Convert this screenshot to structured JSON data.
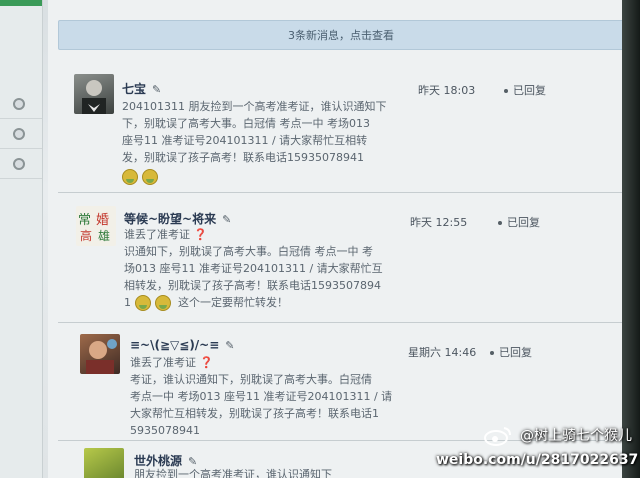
{
  "notice": {
    "text": "3条新消息，点击查看"
  },
  "posts": [
    {
      "author": "七宝",
      "lines": [
        "204101311 朋友捡到一个高考准考证，谁认识通知下",
        "下，别耽误了高考大事。白冠倩 考点一中 考场013",
        "座号11 准考证号204101311 / 请大家帮忙互相转",
        "发，别耽误了孩子高考！联系电话15935078941"
      ],
      "time": "昨天 18:03",
      "status": "已回复"
    },
    {
      "author": "等候~盼望~将来",
      "lines": [
        "谁丢了准考证",
        "识通知下，别耽误了高考大事。白冠倩 考点一中 考",
        "场013 座号11 准考证号204101311 / 请大家帮忙互",
        "相转发，别耽误了孩子高考！联系电话1593507894",
        "1",
        "这个一定要帮忙转发！"
      ],
      "time": "昨天 12:55",
      "status": "已回复"
    },
    {
      "author": "≡~\\(≧▽≦)/~≡",
      "lines": [
        "谁丢了准考证",
        "考证，谁认识通知下，别耽误了高考大事。白冠倩",
        "考点一中 考场013 座号11 准考证号204101311 / 请",
        "大家帮忙互相转发，别耽误了孩子高考！联系电话1",
        "5935078941"
      ],
      "time": "星期六 14:46",
      "status": "已回复"
    },
    {
      "author": "世外桃源",
      "lines": [
        "朋友捡到一个高考准考证，谁认识通知下"
      ]
    }
  ],
  "watermark": {
    "user": "@树上骑七个猴儿",
    "url": "weibo.com/u/2817022637"
  },
  "colors": {
    "notice_bg": "#c9dbe9",
    "author": "#2a3a52",
    "accent_red": "#c23a2a"
  }
}
